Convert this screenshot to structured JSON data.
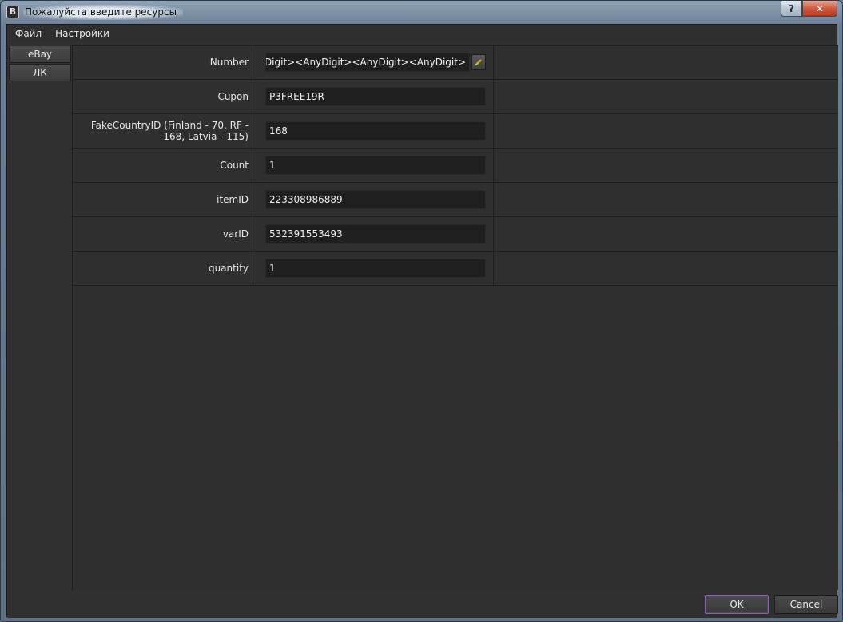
{
  "window": {
    "title": "Пожалуйста введите ресурсы",
    "app_icon_letter": "B",
    "help_glyph": "?",
    "close_glyph": "✕"
  },
  "menu": [
    "Файл",
    "Настройки"
  ],
  "sidebar": {
    "items": [
      {
        "label": "eBay"
      },
      {
        "label": "ЛК"
      }
    ]
  },
  "fields": [
    {
      "label": "Number",
      "value": "<AnyDigit><AnyDigit><AnyDigit><AnyDigit>",
      "has_edit": true
    },
    {
      "label": "Cupon",
      "value": "P3FREE19R"
    },
    {
      "label": "FakeCountryID (Finland - 70, RF - 168, Latvia - 115)",
      "value": "168"
    },
    {
      "label": "Count",
      "value": "1"
    },
    {
      "label": "itemID",
      "value": "223308986889"
    },
    {
      "label": "varID",
      "value": "532391553493"
    },
    {
      "label": "quantity",
      "value": "1"
    }
  ],
  "buttons": {
    "ok": "OK",
    "cancel": "Cancel"
  },
  "colors": {
    "accent_ok_border": "#8c63a8",
    "edit_icon": "#e8b23a"
  }
}
